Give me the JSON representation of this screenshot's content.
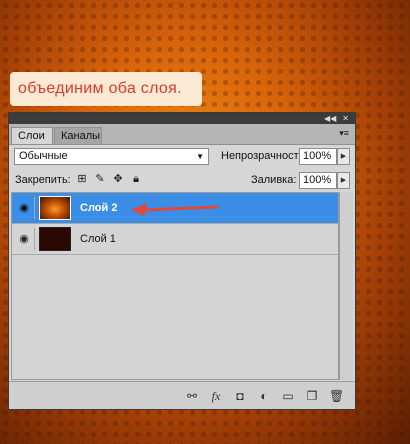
{
  "caption": "объединим оба слоя.",
  "panel": {
    "tabs": [
      "Слои",
      "Каналы"
    ],
    "blend_mode": "Обычные",
    "opacity_label": "Непрозрачность:",
    "opacity_value": "100%",
    "lock_label": "Закрепить:",
    "fill_label": "Заливка:",
    "fill_value": "100%",
    "layers": [
      {
        "name": "Слой 2",
        "selected": true
      },
      {
        "name": "Слой 1",
        "selected": false
      }
    ],
    "footer_icons": [
      "link-icon",
      "fx-icon",
      "mask-icon",
      "adjustment-icon",
      "folder-icon",
      "new-layer-icon",
      "trash-icon"
    ]
  },
  "colors": {
    "selection": "#3a8ee6",
    "arrow": "#e04a3a",
    "caption_text": "#d93a2b"
  }
}
